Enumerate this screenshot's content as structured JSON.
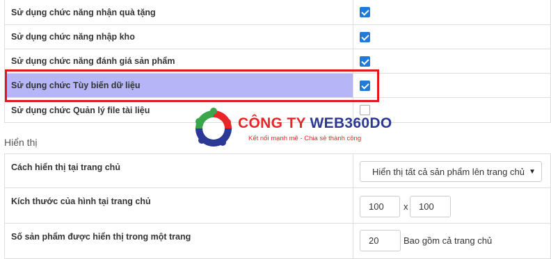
{
  "settings_rows": [
    {
      "label": "Sử dụng chức năng nhận quà tặng",
      "checked": true
    },
    {
      "label": "Sử dụng chức năng nhập kho",
      "checked": true
    },
    {
      "label": "Sử dụng chức năng đánh giá sản phẩm",
      "checked": true
    },
    {
      "label": "Sử dụng chức Tùy biến dữ liệu",
      "checked": true,
      "highlighted": true
    },
    {
      "label": "Sử dụng chức Quản lý file tài liệu",
      "checked": false
    }
  ],
  "display_section": {
    "title": "Hiển thị",
    "homepage_display": {
      "label": "Cách hiển thị tại trang chủ",
      "selected": "Hiển thị tất cả sản phẩm lên trang chủ"
    },
    "image_size": {
      "label": "Kích thước của hình tại trang chủ",
      "width": "100",
      "separator": "x",
      "height": "100"
    },
    "products_per_page": {
      "label": "Số sản phẩm được hiển thị trong một trang",
      "value": "20",
      "note": "Bao gồm cả trang chủ"
    }
  },
  "watermark": {
    "name_part1": "CÔNG TY ",
    "name_part2": "WEB360DO",
    "slogan": "Kết nối mạnh mẽ - Chia sẻ thành công",
    "colors": {
      "red": "#e8262a",
      "blue": "#2b3894",
      "green": "#3aa54a"
    }
  },
  "colors": {
    "highlight": "#b5b5f7",
    "highlight_border": "#e3161c",
    "checkbox": "#1f7ad8"
  }
}
